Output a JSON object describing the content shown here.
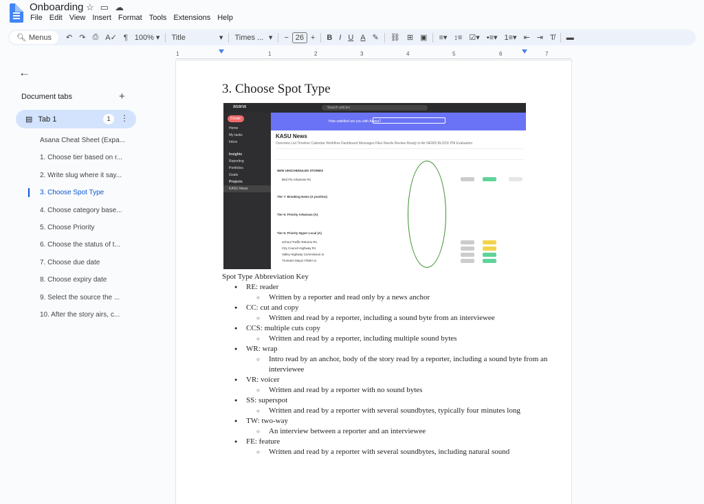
{
  "app": {
    "title": "Onboarding",
    "menu": [
      "File",
      "Edit",
      "View",
      "Insert",
      "Format",
      "Tools",
      "Extensions",
      "Help"
    ]
  },
  "toolbar": {
    "menus_label": "Menus",
    "zoom": "100%",
    "style": "Title",
    "font": "Times ...",
    "font_size": "26"
  },
  "ruler": {
    "ticks": [
      "1",
      "1",
      "2",
      "3",
      "4",
      "5",
      "6",
      "7"
    ]
  },
  "sidebar": {
    "tabs_header": "Document tabs",
    "tab_name": "Tab 1",
    "tab_count": "1",
    "outline": [
      "Asana Cheat Sheet (Expa...",
      "1. Choose tier based on r...",
      "2. Write slug where it say...",
      "3. Choose Spot Type",
      "4. Choose category base...",
      "5. Choose Priority",
      "6. Choose the status of t...",
      "7. Choose due date",
      "8. Choose expiry date",
      "9. Select the source the ...",
      "10. After the story airs, c..."
    ],
    "active_index": 3
  },
  "document": {
    "heading": "3. Choose Spot Type",
    "screenshot": {
      "logo": "asana",
      "search": "Search articles",
      "sidebar_items": [
        "Create",
        "Home",
        "My tasks",
        "Inbox",
        "Insights",
        "Reporting",
        "Portfolios",
        "Goals",
        "Projects",
        "KASU News"
      ],
      "banner": "How satisfied are you with Asana?",
      "project_title": "KASU News",
      "nav": "Overview  List  Timeline  Calendar  Workflow  Dashboard  Messages  Files  Needs Review  Ready to Air  NEWS BLOCK  PM Evaluation",
      "sections": [
        "NEW UNSCHEDULED STORIES",
        "Tier 7: Breaking News (A position)",
        "Tier 6: Priority Arkansas (A)",
        "Tier 5: Priority Hyper Local (A)"
      ],
      "rows": [
        "Bird Flu Arkansas R1",
        "School Traffic Returns R1",
        "City Council Highway R1",
        "Valley Highway Commission to",
        "Trumann Mayor FEMA to"
      ]
    },
    "key_title": "Spot Type Abbreviation Key",
    "items": [
      {
        "term": "RE: reader",
        "desc": "Written by a reporter and read only by a news anchor"
      },
      {
        "term": "CC: cut and copy",
        "desc": "Written and read by a reporter, including a sound byte from an interviewee"
      },
      {
        "term": "CCS: multiple cuts copy",
        "desc": "Written and read by a reporter, including multiple sound bytes"
      },
      {
        "term": "WR: wrap",
        "desc": "Intro read by an anchor, body of the story read by a reporter, including a sound byte from an interviewee"
      },
      {
        "term": "VR: voicer",
        "desc": "Written and read by a reporter with no sound bytes"
      },
      {
        "term": "SS: superspot",
        "desc": "Written and read by a reporter with several soundbytes, typically four minutes long"
      },
      {
        "term": "TW: two-way",
        "desc": "An interview between a reporter and an interviewee"
      },
      {
        "term": "FE: feature",
        "desc": "Written and read by a reporter with several soundbytes, including natural sound"
      }
    ]
  }
}
